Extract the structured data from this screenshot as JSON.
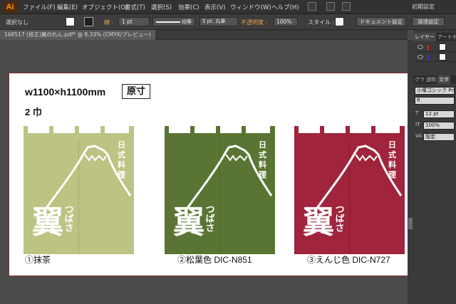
{
  "app": {
    "logo": "Ai"
  },
  "menu": [
    "ファイル(F)",
    "編集(E)",
    "オブジェクト(O)",
    "書式(T)",
    "選択(S)",
    "効果(C)",
    "表示(V)",
    "ウィンドウ(W)",
    "ヘルプ(H)"
  ],
  "workspace": "初期設定",
  "control": {
    "selection": "選択なし",
    "stroke_label": "線 :",
    "stroke_width": "1 pt",
    "uniform": "均等",
    "brush": "5 pt. 丸筆",
    "opacity_label": "不透明度 :",
    "opacity_value": "100%",
    "style_label": "スタイル :",
    "doc_settings": "ドキュメント設定",
    "env_settings": "環境設定"
  },
  "document_tab": "168517 (修正)翼のれん.pdf* @ 8.33% (CMYK/プレビュー)",
  "artboard": {
    "size_text": "w1100×h1100mm",
    "size_box": "原寸",
    "width_text": "2 巾",
    "variants": [
      {
        "label": "①抹茶",
        "color": "#bcc383"
      },
      {
        "label": "②松葉色 DIC-N851",
        "color": "#5a7533"
      },
      {
        "label": "③えんじ色 DIC-N727",
        "color": "#a0243b"
      }
    ],
    "logo_big": "翼",
    "logo_kana": "つばさ",
    "logo_vertical": [
      "日",
      "式",
      "料",
      "理"
    ]
  },
  "panels": {
    "layers_tabs": [
      "レイヤー",
      "アートボード"
    ],
    "char_tabs": [
      "グラ",
      "透明",
      "文字"
    ],
    "font_family": "小塚ゴシック Pr6N",
    "font_style": "R",
    "font_size": "12 pt",
    "scale_v": "100%",
    "tracking": "設定"
  }
}
